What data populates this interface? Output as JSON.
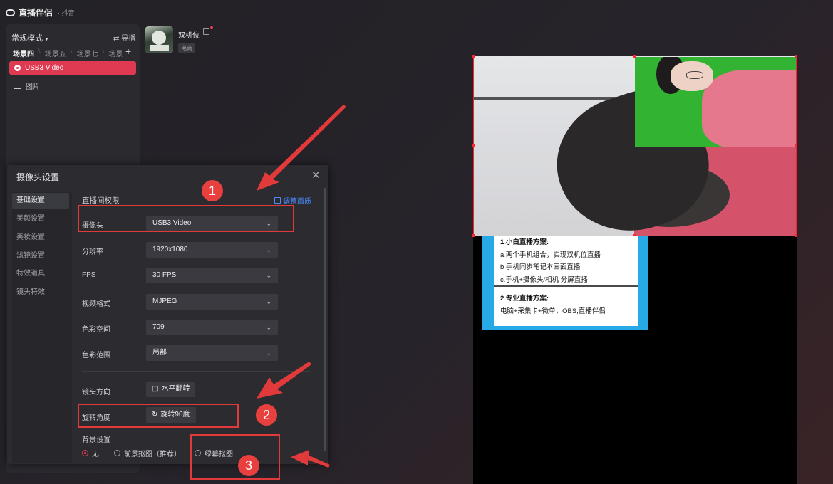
{
  "app": {
    "title": "直播伴侣",
    "subtitle": "· 抖音"
  },
  "left_panel": {
    "mode": "常规模式",
    "guide": "⇄ 导播",
    "scenes": [
      "场景四",
      "场景五",
      "场景七",
      "场景"
    ],
    "add": "+",
    "sources": [
      {
        "label": "USB3 Video"
      },
      {
        "label": "图片"
      }
    ]
  },
  "account": {
    "name": "双机位",
    "tag": "电商"
  },
  "poster": {
    "p1_title": "1.小白直播方案:",
    "p1_items": [
      "a.两个手机组合，实现双机位直播",
      "b.手机同步笔记本画面直播",
      "c.手机+摄像头/相机 分屏直播"
    ],
    "p2_title": "2.专业直播方案:",
    "p2_text": "电脑+采集卡+微单，OBS,直播伴侣"
  },
  "dialog": {
    "title": "摄像头设置",
    "close": "✕",
    "nav": [
      "基础设置",
      "美颜设置",
      "美妆设置",
      "滤镜设置",
      "特效道具",
      "镜头特效"
    ],
    "section": "直播间权限",
    "adjust": "调整画质",
    "rows": [
      {
        "label": "摄像头",
        "value": "USB3 Video"
      },
      {
        "label": "分辨率",
        "value": "1920x1080"
      },
      {
        "label": "FPS",
        "value": "30 FPS"
      },
      {
        "label": "视频格式",
        "value": "MJPEG"
      },
      {
        "label": "色彩空间",
        "value": "709"
      },
      {
        "label": "色彩范围",
        "value": "局部"
      }
    ],
    "mirror": {
      "label": "镜头方向",
      "button": "水平翻转"
    },
    "rotate": {
      "label": "旋转角度",
      "button": "旋转90度"
    },
    "background": {
      "label": "背景设置",
      "options": [
        "无",
        "前景抠图（推荐）",
        "绿幕抠图"
      ],
      "selected": "无"
    }
  },
  "annotations": [
    "1",
    "2",
    "3"
  ]
}
